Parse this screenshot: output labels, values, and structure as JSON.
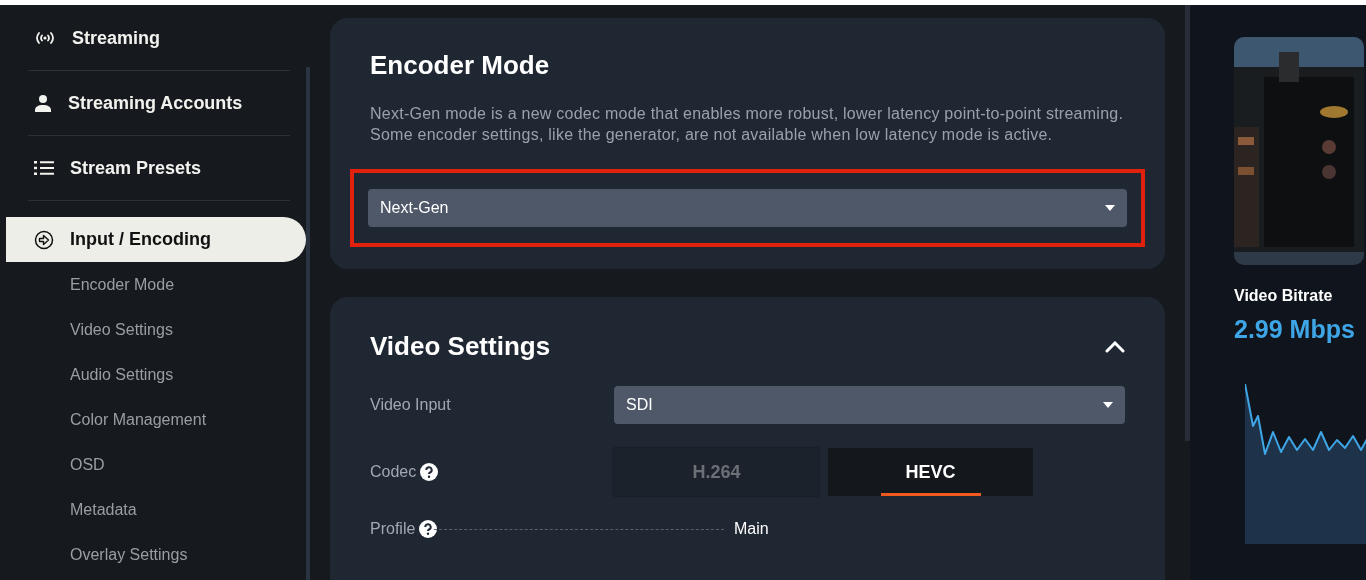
{
  "sidebar": {
    "items": [
      {
        "label": "Streaming",
        "selected": false
      },
      {
        "label": "Streaming Accounts",
        "selected": false
      },
      {
        "label": "Stream Presets",
        "selected": false
      },
      {
        "label": "Input / Encoding",
        "selected": true,
        "children": [
          {
            "label": "Encoder Mode"
          },
          {
            "label": "Video Settings"
          },
          {
            "label": "Audio Settings"
          },
          {
            "label": "Color Management"
          },
          {
            "label": "OSD"
          },
          {
            "label": "Metadata"
          },
          {
            "label": "Overlay Settings"
          }
        ]
      }
    ]
  },
  "encoder_mode": {
    "title": "Encoder Mode",
    "description": "Next-Gen mode is a new codec mode that enables more robust, lower latency point-to-point streaming. Some encoder settings, like the generator, are not available when low latency mode is active.",
    "select": {
      "value": "Next-Gen",
      "highlighted": true
    }
  },
  "video_settings": {
    "title": "Video Settings",
    "expanded": true,
    "rows": [
      {
        "kind": "select",
        "label": "Video Input",
        "value": "SDI"
      },
      {
        "kind": "segmented",
        "label": "Codec",
        "help": true,
        "options": [
          {
            "label": "H.264",
            "selected": false
          },
          {
            "label": "HEVC",
            "selected": true
          }
        ]
      },
      {
        "kind": "static",
        "label": "Profile",
        "help": true,
        "value": "Main"
      }
    ]
  },
  "preview": {
    "kind": "picture",
    "metric_label": "Video Bitrate",
    "metric_value": "2.99 Mbps"
  }
}
